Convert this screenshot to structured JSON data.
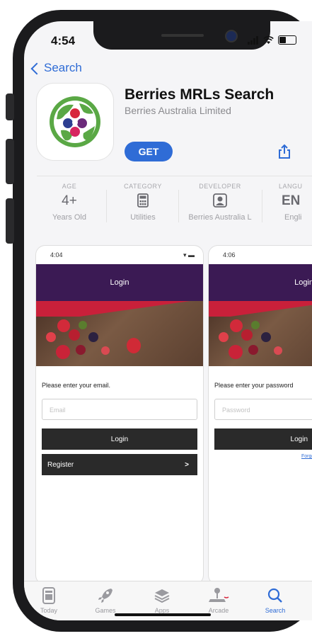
{
  "status": {
    "time": "4:54"
  },
  "nav": {
    "back_label": "Search"
  },
  "app": {
    "title": "Berries MRLs Search",
    "developer": "Berries Australia Limited",
    "get_label": "GET"
  },
  "info": {
    "age": {
      "label": "AGE",
      "value": "4+",
      "sub": "Years Old"
    },
    "category": {
      "label": "CATEGORY",
      "sub": "Utilities",
      "icon": "calculator-icon"
    },
    "developer": {
      "label": "DEVELOPER",
      "sub": "Berries Australia L",
      "icon": "person-square-icon"
    },
    "language": {
      "label": "LANGU",
      "value": "EN",
      "sub": "Engli"
    }
  },
  "screenshots": [
    {
      "time": "4:04",
      "header": "Login",
      "prompt": "Please enter your email.",
      "placeholder": "Email",
      "button": "Login",
      "register": "Register",
      "register_arrow": ">"
    },
    {
      "time": "4:06",
      "header": "Login",
      "prompt": "Please enter your password",
      "placeholder": "Password",
      "button": "Login",
      "forgot": "Forgot your pas"
    }
  ],
  "tabs": [
    {
      "label": "Today",
      "icon": "today-icon"
    },
    {
      "label": "Games",
      "icon": "rocket-icon"
    },
    {
      "label": "Apps",
      "icon": "layers-icon"
    },
    {
      "label": "Arcade",
      "icon": "joystick-icon"
    },
    {
      "label": "Search",
      "icon": "search-icon",
      "active": true
    }
  ],
  "colors": {
    "accent": "#2f6cd6",
    "header": "#3b1a54",
    "berry_red": "#c9203a"
  }
}
